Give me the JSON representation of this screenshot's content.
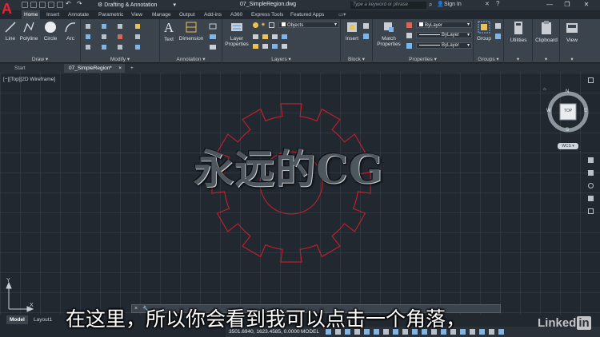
{
  "app": {
    "workspace": "Drafting & Annotation",
    "file_title": "07_SimpleRegion.dwg",
    "search_placeholder": "Type a keyword or phrase",
    "signin": "Sign In"
  },
  "ribbon_tabs": [
    "Home",
    "Insert",
    "Annotate",
    "Parametric",
    "View",
    "Manage",
    "Output",
    "Add-ins",
    "A360",
    "Express Tools",
    "Featured Apps"
  ],
  "draw_panel": {
    "title": "Draw",
    "line": "Line",
    "polyline": "Polyline",
    "circle": "Circle",
    "arc": "Arc"
  },
  "modify_panel": {
    "title": "Modify"
  },
  "annotation_panel": {
    "title": "Annotation",
    "text": "Text",
    "dimension": "Dimension"
  },
  "layers_panel": {
    "title": "Layers",
    "layer_properties": "Layer Properties",
    "current_layer": "Objects"
  },
  "block_panel": {
    "title": "Block",
    "insert": "Insert"
  },
  "properties_panel": {
    "title": "Properties",
    "match_properties": "Match Properties",
    "color": "ByLayer",
    "linetype": "ByLayer",
    "lineweight": "ByLayer"
  },
  "groups_panel": {
    "title": "Groups",
    "group": "Group"
  },
  "utilities": {
    "label": "Utilities"
  },
  "clipboard": {
    "label": "Clipboard"
  },
  "view_btn": {
    "label": "View"
  },
  "file_tabs": {
    "start": "Start",
    "current": "07_SimpleRegion*"
  },
  "viewport_label": "[−][Top][2D Wireframe]",
  "viewcube": {
    "top": "TOP",
    "n": "N",
    "s": "S",
    "e": "E",
    "w": "W",
    "wcs": "WCS"
  },
  "layout_tabs": [
    "Model",
    "Layout1"
  ],
  "status": {
    "coords": "3501.6940, 1623.4585, 0.0000",
    "mode": "MODEL"
  },
  "overlay": {
    "watermark": "永远的CG",
    "subtitle": "在这里，所以你会看到我可以点击一个角落，",
    "brand": "Linked",
    "brand_in": "in"
  },
  "colors": {
    "gear": "#c8202b",
    "accent": "#e32636",
    "ribbon": "#3b434c",
    "canvas": "#212830"
  }
}
